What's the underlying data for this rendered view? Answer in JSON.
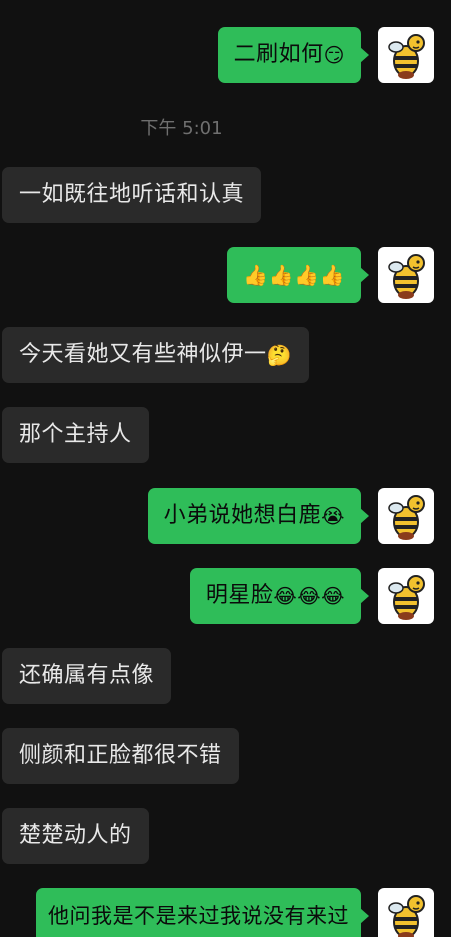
{
  "timestamp": "下午 5:01",
  "messages": [
    {
      "side": "out",
      "text": "二刷如何",
      "emoji": "😏"
    },
    {
      "side": "in",
      "text": "一如既往地听话和认真"
    },
    {
      "side": "out",
      "text": "",
      "emoji": "👍👍👍👍"
    },
    {
      "side": "in",
      "text": "今天看她又有些神似伊一",
      "emoji": "🤔"
    },
    {
      "side": "in",
      "text": "那个主持人"
    },
    {
      "side": "out",
      "text": "小弟说她想白鹿",
      "emoji": "😭"
    },
    {
      "side": "out",
      "text": "明星脸",
      "emoji": "😂😂😂"
    },
    {
      "side": "in",
      "text": "还确属有点像"
    },
    {
      "side": "in",
      "text": "侧颜和正脸都很不错"
    },
    {
      "side": "in",
      "text": "楚楚动人的"
    },
    {
      "side": "out",
      "text": "他问我是不是来过我说没有来过"
    }
  ],
  "avatar_icon": "bee-avatar-icon",
  "colors": {
    "background": "#111111",
    "outgoing_bubble": "#2fbd59",
    "incoming_bubble": "#2a2a2a",
    "timestamp": "#6f6f6f"
  }
}
